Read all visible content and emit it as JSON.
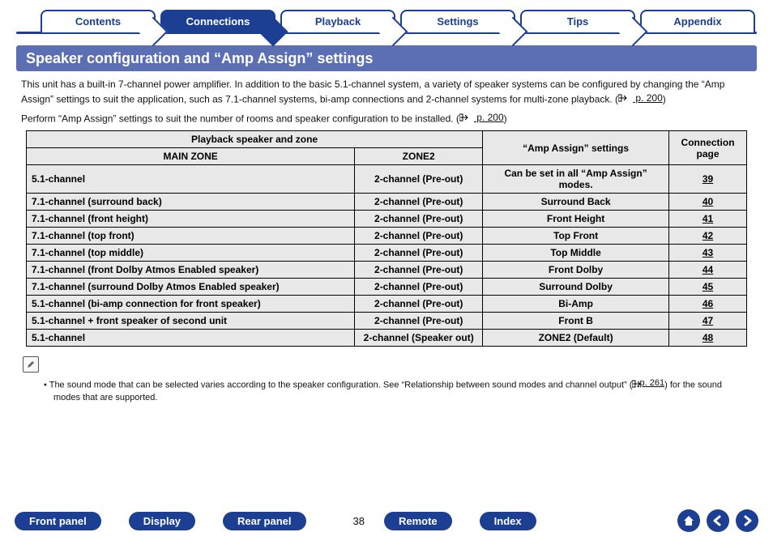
{
  "tabs": {
    "items": [
      "Contents",
      "Connections",
      "Playback",
      "Settings",
      "Tips",
      "Appendix"
    ],
    "active_index": 1
  },
  "section_title": "Speaker configuration and “Amp Assign” settings",
  "intro": {
    "p1": "This unit has a built-in 7-channel power amplifier. In addition to the basic 5.1-channel system, a variety of speaker systems can be configured by changing the “Amp Assign” settings to suit the application, such as 7.1-channel systems, bi-amp connections and 2-channel systems for multi-zone playback.",
    "p1_ref_open": "  (",
    "p1_ref_label": " p. 200",
    "p1_ref_close": ")",
    "p2": "Perform “Amp Assign” settings to suit the number of rooms and speaker configuration to be installed.  (",
    "p2_ref_label": " p. 200",
    "p2_ref_close": ")"
  },
  "table": {
    "head_playback": "Playback speaker and zone",
    "head_main": "MAIN ZONE",
    "head_zone2": "ZONE2",
    "head_amp": "“Amp Assign” settings",
    "head_conn": "Connection page",
    "rows": [
      {
        "mz": "5.1-channel",
        "z2": "2-channel (Pre-out)",
        "aa": "Can be set in all “Amp Assign” modes.",
        "pg": "39"
      },
      {
        "mz": "7.1-channel (surround back)",
        "z2": "2-channel (Pre-out)",
        "aa": "Surround Back",
        "pg": "40"
      },
      {
        "mz": "7.1-channel (front height)",
        "z2": "2-channel (Pre-out)",
        "aa": "Front Height",
        "pg": "41"
      },
      {
        "mz": "7.1-channel (top front)",
        "z2": "2-channel (Pre-out)",
        "aa": "Top Front",
        "pg": "42"
      },
      {
        "mz": "7.1-channel (top middle)",
        "z2": "2-channel (Pre-out)",
        "aa": "Top Middle",
        "pg": "43"
      },
      {
        "mz": "7.1-channel (front Dolby Atmos Enabled speaker)",
        "z2": "2-channel (Pre-out)",
        "aa": "Front Dolby",
        "pg": "44"
      },
      {
        "mz": "7.1-channel (surround Dolby Atmos Enabled speaker)",
        "z2": "2-channel (Pre-out)",
        "aa": "Surround Dolby",
        "pg": "45"
      },
      {
        "mz": "5.1-channel (bi-amp connection for front speaker)",
        "z2": "2-channel (Pre-out)",
        "aa": "Bi-Amp",
        "pg": "46"
      },
      {
        "mz": "5.1-channel + front speaker of second unit",
        "z2": "2-channel (Pre-out)",
        "aa": "Front B",
        "pg": "47"
      },
      {
        "mz": "5.1-channel",
        "z2": "2-channel (Speaker out)",
        "aa": "ZONE2 (Default)",
        "pg": "48"
      }
    ]
  },
  "note": {
    "text_a": "The sound mode that can be selected varies according to the speaker configuration. See “Relationship between sound modes and channel output”  (",
    "ref_label": " p. 261",
    "text_b": ") for the sound modes that are supported."
  },
  "bottom": {
    "front_panel": "Front panel",
    "display": "Display",
    "rear_panel": "Rear panel",
    "page_number": "38",
    "remote": "Remote",
    "index": "Index"
  }
}
